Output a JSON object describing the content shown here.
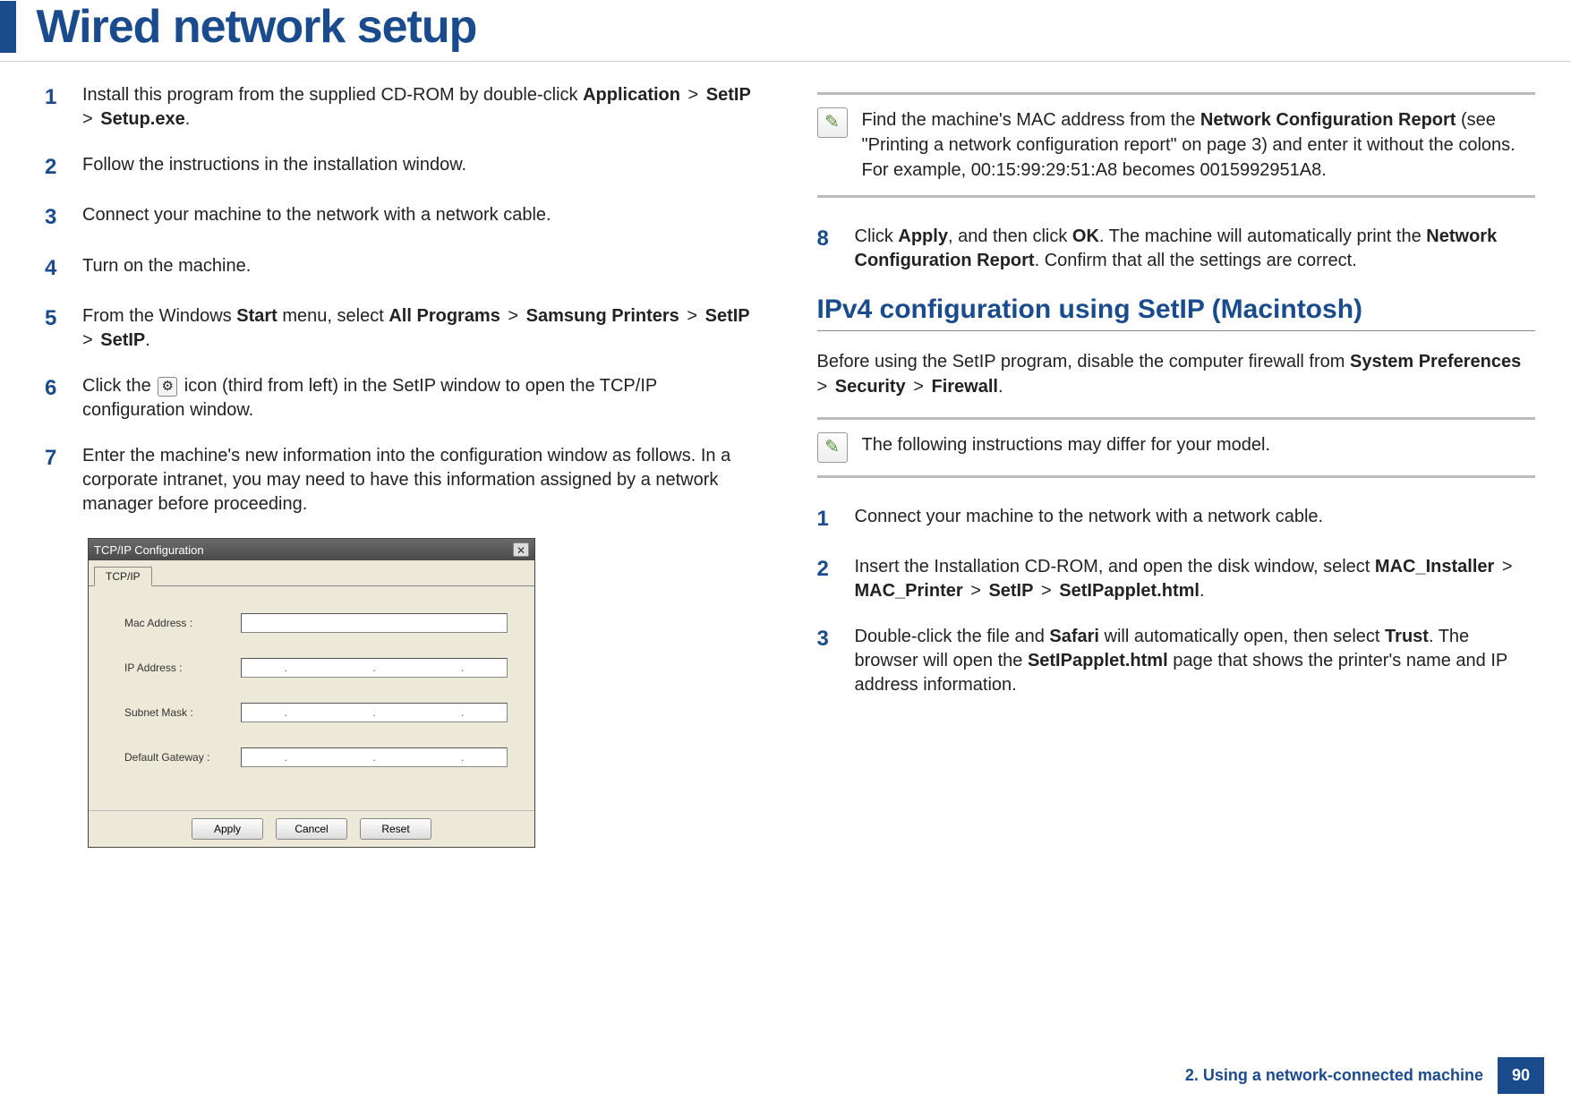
{
  "header": {
    "title": "Wired network setup"
  },
  "left": {
    "steps": [
      {
        "n": "1",
        "parts": [
          "Install this program from the supplied CD-ROM by double-click ",
          "Application",
          " > ",
          "SetIP",
          " > ",
          "Setup.exe",
          "."
        ]
      },
      {
        "n": "2",
        "parts": [
          "Follow the instructions in the installation window."
        ]
      },
      {
        "n": "3",
        "parts": [
          "Connect your machine to the network with a network cable."
        ]
      },
      {
        "n": "4",
        "parts": [
          "Turn on the machine."
        ]
      },
      {
        "n": "5",
        "parts": [
          "From the Windows ",
          "Start",
          " menu, select ",
          "All Programs",
          " > ",
          "Samsung Printers",
          " > ",
          "SetIP",
          " > ",
          "SetIP",
          "."
        ]
      },
      {
        "n": "6",
        "parts": [
          "Click the ",
          "[gear]",
          " icon (third from left) in the SetIP window to open the TCP/IP configuration window."
        ]
      },
      {
        "n": "7",
        "parts": [
          "Enter the machine's new information into the configuration window as follows. In a corporate intranet, you may need to have this information assigned by a network manager before proceeding."
        ]
      }
    ]
  },
  "dialog": {
    "title": "TCP/IP Configuration",
    "tab": "TCP/IP",
    "fields": {
      "mac": "Mac Address :",
      "ip": "IP Address :",
      "subnet": "Subnet Mask :",
      "gateway": "Default Gateway :"
    },
    "buttons": {
      "apply": "Apply",
      "cancel": "Cancel",
      "reset": "Reset"
    }
  },
  "right": {
    "note1": "Find the machine's MAC address from the Network Configuration Report (see \"Printing a network configuration report\" on page 3) and enter it without the colons. For example, 00:15:99:29:51:A8 becomes 0015992951A8.",
    "note1_bold": "Network Configuration Report",
    "step8": {
      "n": "8",
      "parts": [
        "Click ",
        "Apply",
        ", and then click ",
        "OK",
        ". The machine will automatically print the ",
        "Network Configuration Report",
        ". Confirm that all the settings are correct."
      ]
    },
    "subheading": "IPv4 configuration using SetIP (Macintosh)",
    "intro": {
      "parts": [
        "Before using the SetIP program, disable the computer firewall from ",
        "System Preferences",
        " > ",
        "Security",
        " > ",
        "Firewall",
        "."
      ]
    },
    "note2": "The following instructions may differ for your model.",
    "mac_steps": [
      {
        "n": "1",
        "parts": [
          "Connect your machine to the network with a network cable."
        ]
      },
      {
        "n": "2",
        "parts": [
          "Insert the Installation CD-ROM, and open the disk window, select ",
          "MAC_Installer",
          " > ",
          "MAC_Printer",
          " > ",
          "SetIP",
          " > ",
          "SetIPapplet.html",
          "."
        ]
      },
      {
        "n": "3",
        "parts": [
          "Double-click the file and ",
          "Safari",
          " will automatically open, then select ",
          "Trust",
          ". The browser will open the ",
          "SetIPapplet.html",
          " page that shows the printer's name and IP address information."
        ]
      }
    ]
  },
  "footer": {
    "chapter": "2. Using a network-connected machine",
    "page": "90"
  }
}
